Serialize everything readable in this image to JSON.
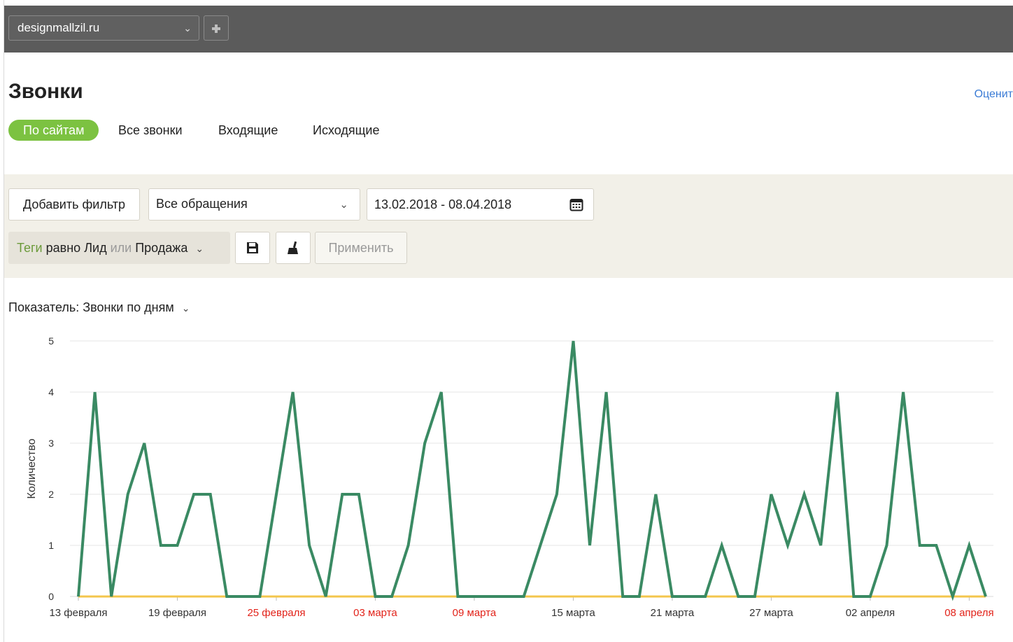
{
  "topbar": {
    "site": "designmallzil.ru"
  },
  "header": {
    "title": "Звонки",
    "rate_link": "Оценит"
  },
  "tabs": [
    {
      "label": "По сайтам",
      "active": true
    },
    {
      "label": "Все звонки",
      "active": false
    },
    {
      "label": "Входящие",
      "active": false
    },
    {
      "label": "Исходящие",
      "active": false
    }
  ],
  "filters": {
    "add_filter": "Добавить фильтр",
    "request_type": "Все обращения",
    "date_range": "13.02.2018 - 08.04.2018",
    "tag_field": "Теги",
    "tag_op": "равно",
    "tag_value1": "Лид",
    "tag_or": "или",
    "tag_value2": "Продажа",
    "apply": "Применить"
  },
  "indicator": {
    "label": "Показатель:",
    "value": "Звонки по дням"
  },
  "colors": {
    "accent_green": "#7cc241",
    "series_line": "#3a8a63",
    "baseline": "#f3c64c",
    "weekend_label": "#e2231a"
  },
  "chart_data": {
    "type": "line",
    "ylabel": "Количество",
    "ylim": [
      0,
      5
    ],
    "yticks": [
      0,
      1,
      2,
      3,
      4,
      5
    ],
    "x_start": "13 февраля",
    "x_end": "08 апреля",
    "xticks": [
      {
        "label": "13 февраля",
        "index": 0,
        "weekend": false
      },
      {
        "label": "19 февраля",
        "index": 6,
        "weekend": false
      },
      {
        "label": "25 февраля",
        "index": 12,
        "weekend": true
      },
      {
        "label": "03 марта",
        "index": 18,
        "weekend": true
      },
      {
        "label": "09 марта",
        "index": 24,
        "weekend": true
      },
      {
        "label": "15 марта",
        "index": 30,
        "weekend": false
      },
      {
        "label": "21 марта",
        "index": 36,
        "weekend": false
      },
      {
        "label": "27 марта",
        "index": 42,
        "weekend": false
      },
      {
        "label": "02 апреля",
        "index": 48,
        "weekend": false
      },
      {
        "label": "08 апреля",
        "index": 54,
        "weekend": true
      }
    ],
    "series": [
      {
        "color": "#3a8a63",
        "values": [
          0,
          4,
          0,
          2,
          3,
          1,
          1,
          2,
          2,
          0,
          0,
          0,
          2,
          4,
          1,
          0,
          2,
          2,
          0,
          0,
          1,
          3,
          4,
          0,
          0,
          0,
          0,
          0,
          1,
          2,
          5,
          1,
          4,
          0,
          0,
          2,
          0,
          0,
          0,
          1,
          0,
          0,
          2,
          1,
          2,
          1,
          4,
          0,
          0,
          1,
          4,
          1,
          1,
          0,
          1,
          0
        ]
      },
      {
        "color": "#f3c64c",
        "values": [
          0,
          0,
          0,
          0,
          0,
          0,
          0,
          0,
          0,
          0,
          0,
          0,
          0,
          0,
          0,
          0,
          0,
          0,
          0,
          0,
          0,
          0,
          0,
          0,
          0,
          0,
          0,
          0,
          0,
          0,
          0,
          0,
          0,
          0,
          0,
          0,
          0,
          0,
          0,
          0,
          0,
          0,
          0,
          0,
          0,
          0,
          0,
          0,
          0,
          0,
          0,
          0,
          0,
          0,
          0,
          0
        ]
      }
    ]
  }
}
